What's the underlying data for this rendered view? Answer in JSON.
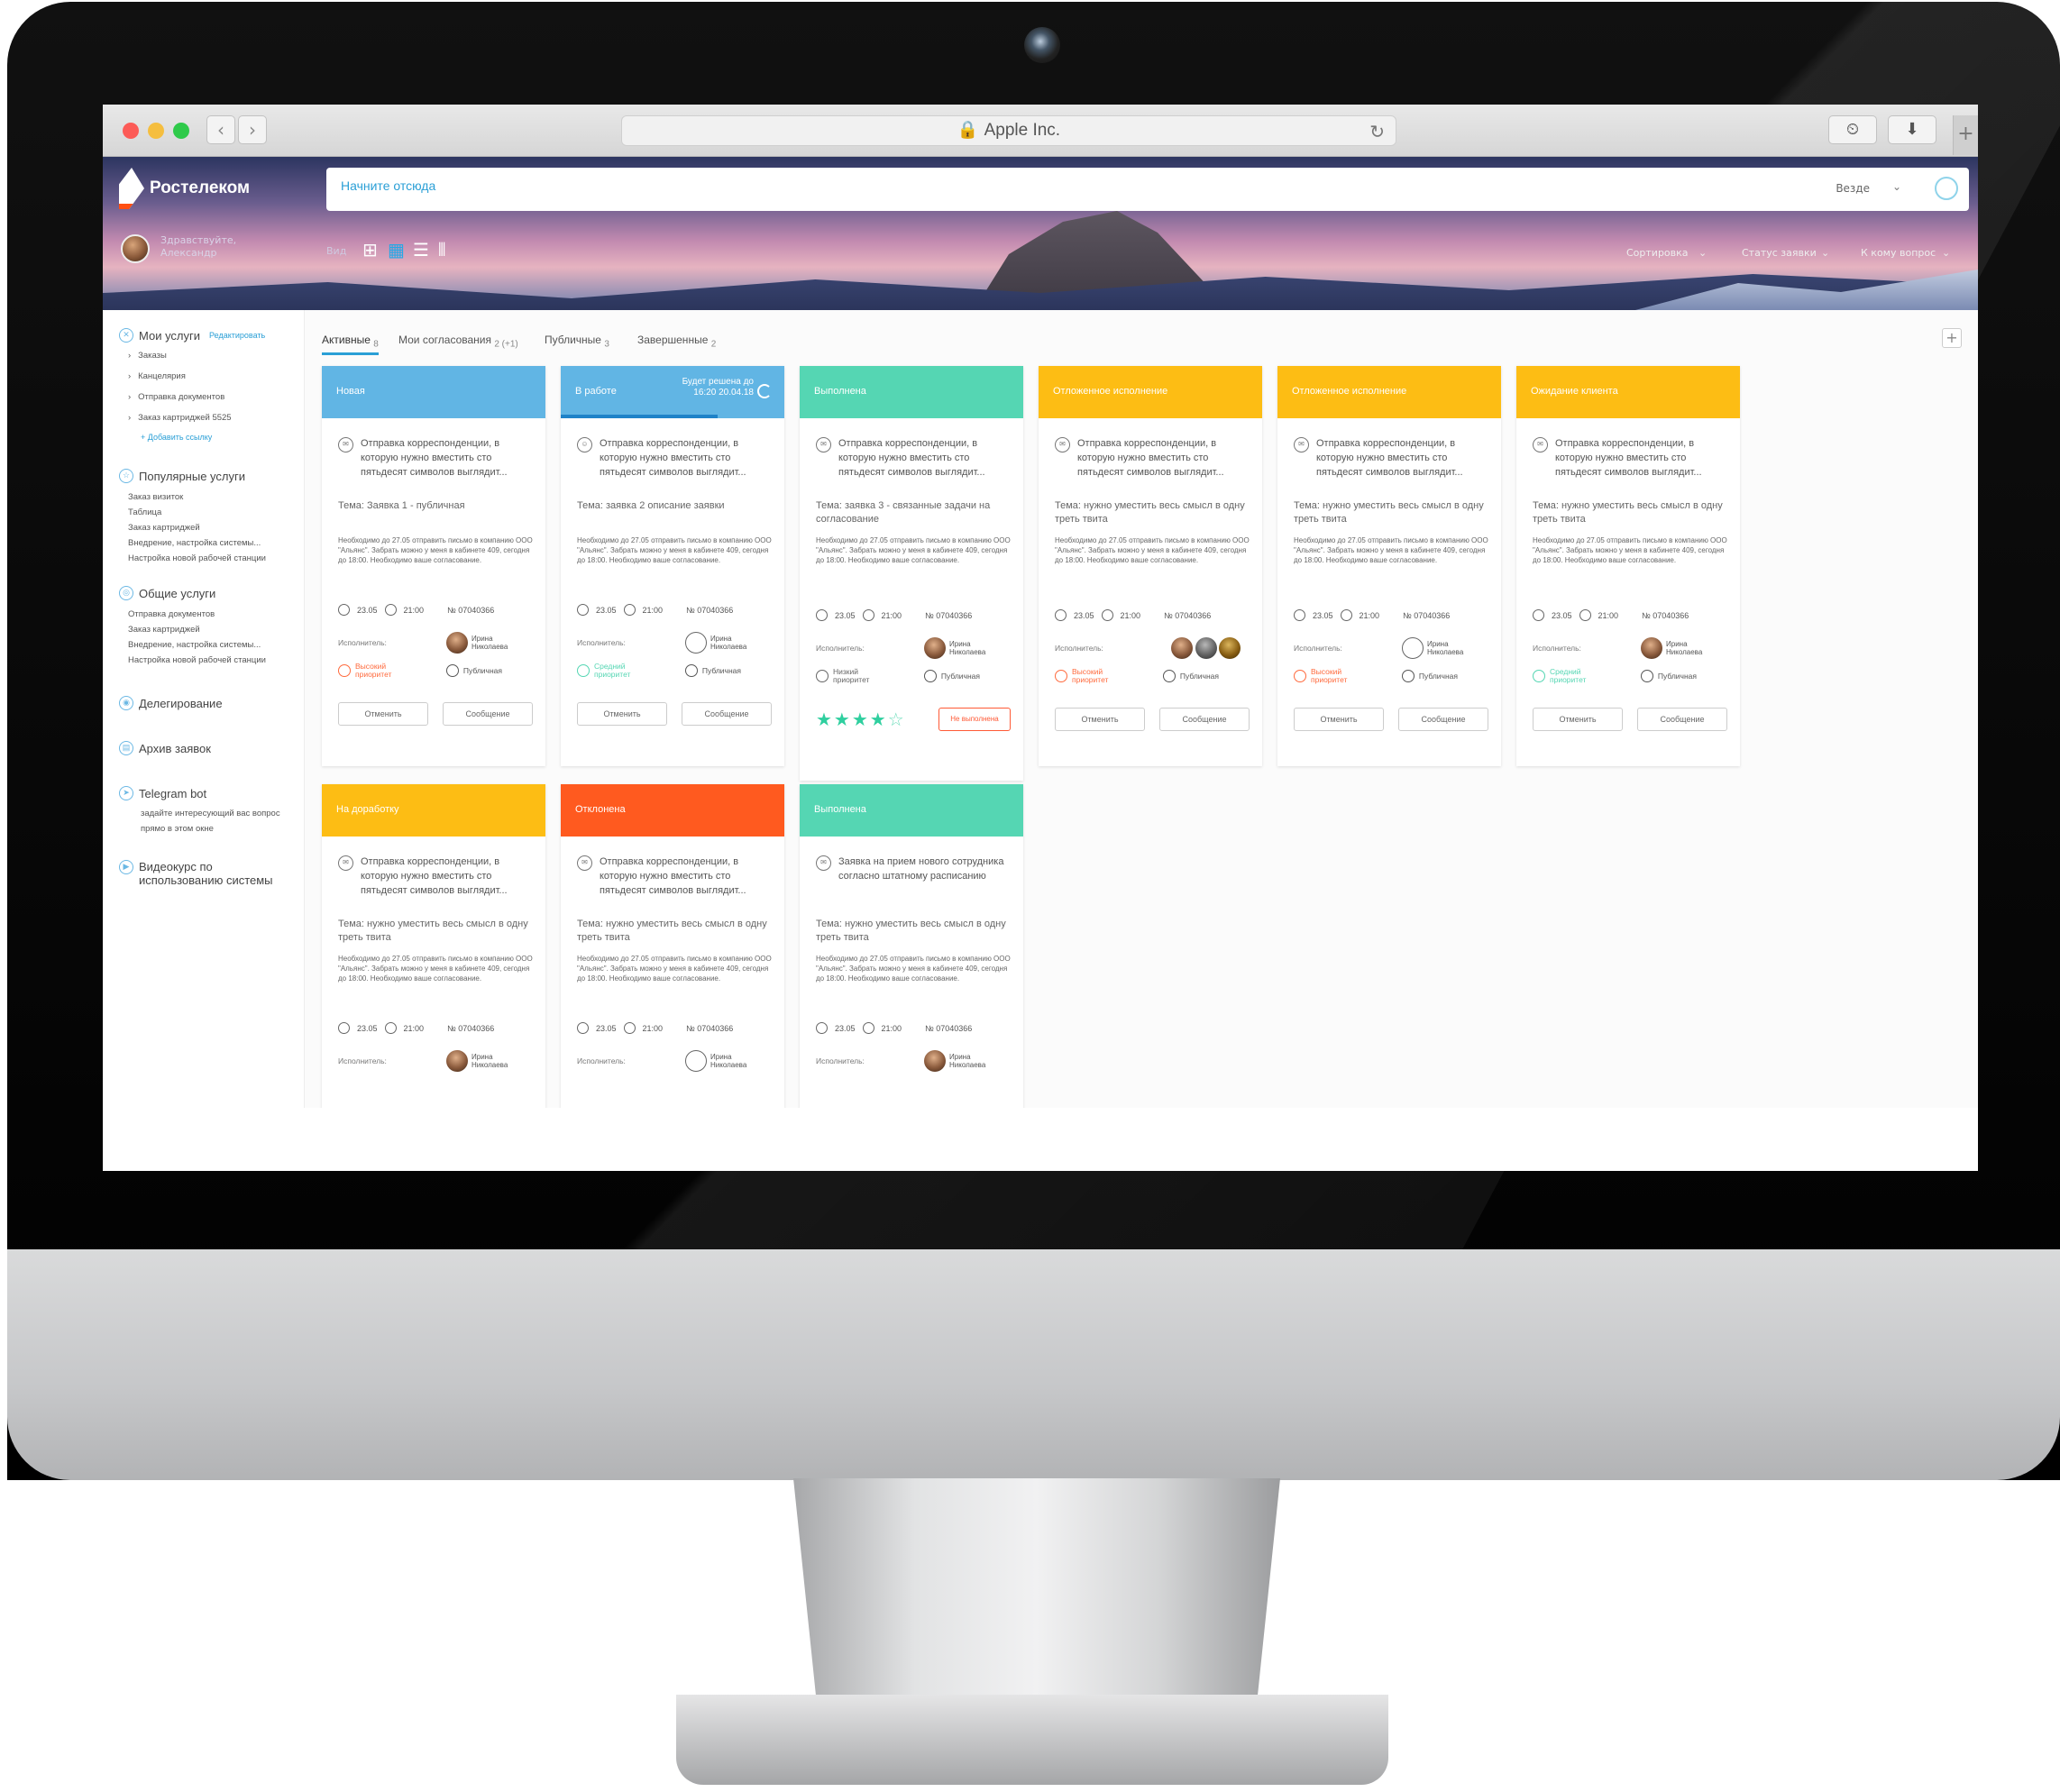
{
  "browser": {
    "url_title": "Apple Inc.",
    "nav_back": "‹",
    "nav_forward": "›"
  },
  "brand": {
    "logo_text": "Ростелеком",
    "accent": "#26a8e6",
    "logo_accent": "#ff4f12"
  },
  "search": {
    "placeholder": "Начните отсюда",
    "scope": "Везде"
  },
  "user": {
    "greeting_line1": "Здравствуйте,",
    "greeting_line2": "Александр"
  },
  "view": {
    "label": "Вид"
  },
  "filters": [
    "Сортировка",
    "Статус заявки",
    "К кому вопрос"
  ],
  "sidebar": {
    "my_services": "Мои услуги",
    "edit": "Редактировать",
    "my_items": [
      "Заказы",
      "Канцелярия",
      "Отправка документов",
      "Заказ картриджей 5525"
    ],
    "add_link": "+ Добавить ссылку",
    "popular": "Популярные услуги",
    "popular_items": [
      "Заказ визиток",
      "Таблица",
      "Заказ картриджей",
      "Внедрение, настройка системы...",
      "Настройка новой рабочей станции"
    ],
    "general": "Общие услуги",
    "general_items": [
      "Отправка документов",
      "Заказ картриджей",
      "Внедрение, настройка системы...",
      "Настройка новой рабочей станции"
    ],
    "delegation": "Делегирование",
    "archive": "Архив заявок",
    "telegram": "Telegram bot",
    "telegram_desc1": "задайте интересующий вас вопрос",
    "telegram_desc2": "прямо в этом окне",
    "video1": "Видеокурс по",
    "video2": "использованию системы"
  },
  "tabs": [
    {
      "label": "Активные",
      "count": "8"
    },
    {
      "label": "Мои согласования",
      "count": "2 (+1)"
    },
    {
      "label": "Публичные",
      "count": "3"
    },
    {
      "label": "Завершенные",
      "count": "2"
    }
  ],
  "common": {
    "title_default": "Отправка корреспонденции, в которую нужно вместить сто пятьдесят символов выглядит...",
    "description": "Необходимо до 27.05 отправить письмо в компанию ООО \"Альянс\". Забрать можно у меня в кабинете 409, сегодня до 18:00. Необходимо ваше согласование.",
    "date": "23.05",
    "time": "21:00",
    "number": "№ 07040366",
    "executor_label": "Исполнитель:",
    "executor_name": "Ирина Николаева",
    "public": "Публичная",
    "cancel": "Отменить",
    "message": "Сообщение",
    "not_done": "Не выполнена"
  },
  "cards": [
    {
      "status": "Новая",
      "theme": "Тема: Заявка 1 - публичная",
      "priority": "Высокий приоритет"
    },
    {
      "status": "В работе",
      "extra1": "Будет решена до",
      "extra2": "16:20  20.04.18",
      "theme": "Тема: заявка 2 описание заявки",
      "priority": "Средний приоритет"
    },
    {
      "status": "Выполнена",
      "theme": "Тема: заявка 3 - связанные задачи на согласование",
      "priority": "Низкий приоритет",
      "rating": "★★★★",
      "rating_empty": "☆"
    },
    {
      "status": "Отложенное исполнение",
      "theme": "Тема: нужно уместить весь смысл в одну треть твита",
      "priority": "Высокий приоритет"
    },
    {
      "status": "Отложенное исполнение",
      "theme": "Тема: нужно уместить весь смысл в одну треть твита",
      "priority": "Высокий приоритет"
    },
    {
      "status": "Ожидание клиента",
      "theme": "Тема: нужно уместить весь смысл в одну треть твита",
      "priority": "Средний приоритет"
    },
    {
      "status": "На доработку",
      "theme": "Тема: нужно уместить весь смысл в одну треть твита"
    },
    {
      "status": "Отклонена",
      "theme": "Тема: нужно уместить весь смысл в одну треть твита"
    },
    {
      "status": "Выполнена",
      "title": "Заявка на прием нового сотрудника согласно штатному расписанию",
      "theme": "Тема: нужно уместить весь смысл в одну треть твита"
    }
  ],
  "colors": {
    "blue": "#61b5e4",
    "green": "#55d6b3",
    "yellow": "#fdbd14",
    "red": "#ff5a1f",
    "priority_high": "#ff6a3d",
    "priority_mid": "#55d6b3"
  }
}
